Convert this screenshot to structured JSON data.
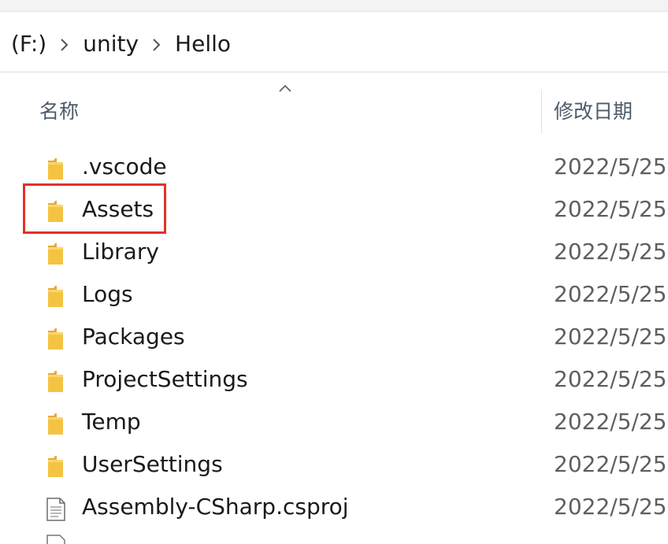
{
  "breadcrumb": {
    "items": [
      "(F:)",
      "unity",
      "Hello"
    ]
  },
  "header": {
    "name_label": "名称",
    "date_label": "修改日期",
    "sort_indicator": "chevron-up-icon"
  },
  "files": [
    {
      "name": ".vscode",
      "date": "2022/5/25",
      "type": "folder",
      "icon": "folder-icon"
    },
    {
      "name": "Assets",
      "date": "2022/5/25",
      "type": "folder",
      "icon": "folder-icon",
      "highlighted": true
    },
    {
      "name": "Library",
      "date": "2022/5/25",
      "type": "folder",
      "icon": "folder-icon"
    },
    {
      "name": "Logs",
      "date": "2022/5/25",
      "type": "folder",
      "icon": "folder-icon"
    },
    {
      "name": "Packages",
      "date": "2022/5/25",
      "type": "folder",
      "icon": "folder-icon"
    },
    {
      "name": "ProjectSettings",
      "date": "2022/5/25",
      "type": "folder",
      "icon": "folder-icon"
    },
    {
      "name": "Temp",
      "date": "2022/5/25",
      "type": "folder",
      "icon": "folder-icon"
    },
    {
      "name": "UserSettings",
      "date": "2022/5/25",
      "type": "folder",
      "icon": "folder-icon"
    },
    {
      "name": "Assembly-CSharp.csproj",
      "date": "2022/5/25",
      "type": "file",
      "icon": "document-icon"
    }
  ],
  "colors": {
    "folder": "#f5c342",
    "highlight_border": "#e0322b",
    "header_text": "#4d5a6b"
  }
}
